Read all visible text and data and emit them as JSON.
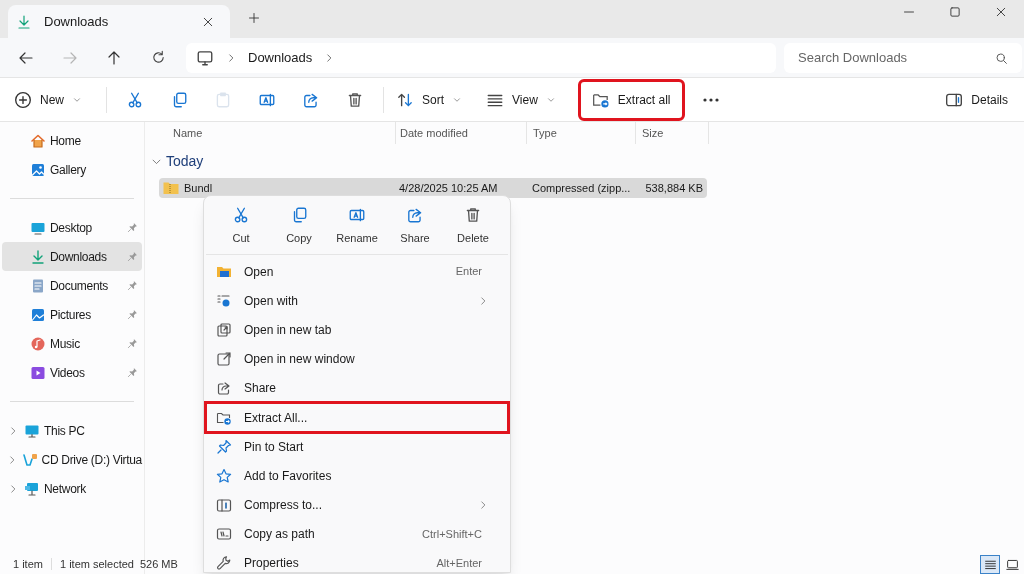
{
  "tab": {
    "title": "Downloads",
    "selected": true
  },
  "breadcrumb": [
    "Downloads"
  ],
  "search": {
    "placeholder": "Search Downloads"
  },
  "toolbar": [
    {
      "label": "New",
      "dropdown": true,
      "disabled": false,
      "highlighted": false
    },
    {
      "disabled": false,
      "highlighted": false,
      "kind": "cut"
    },
    {
      "disabled": false,
      "highlighted": false,
      "kind": "copy"
    },
    {
      "disabled": true,
      "highlighted": false,
      "kind": "paste"
    },
    {
      "disabled": false,
      "highlighted": false,
      "kind": "rename"
    },
    {
      "disabled": false,
      "highlighted": false,
      "kind": "share"
    },
    {
      "disabled": false,
      "highlighted": false,
      "kind": "delete"
    },
    {
      "label": "Sort",
      "dropdown": true,
      "disabled": false,
      "highlighted": false,
      "kind": "sort"
    },
    {
      "label": "View",
      "dropdown": true,
      "disabled": false,
      "highlighted": false,
      "kind": "view"
    },
    {
      "label": "Extract all",
      "disabled": false,
      "highlighted": true,
      "kind": "extract"
    },
    {
      "disabled": false,
      "highlighted": false,
      "kind": "more"
    }
  ],
  "details_button": "Details",
  "sidebar": [
    [
      {
        "label": "Home",
        "selected": false,
        "pinned": false
      },
      {
        "label": "Gallery",
        "selected": false,
        "pinned": false
      }
    ],
    [
      {
        "label": "Desktop",
        "selected": false,
        "pinned": true
      },
      {
        "label": "Downloads",
        "selected": true,
        "pinned": true
      },
      {
        "label": "Documents",
        "selected": false,
        "pinned": true
      },
      {
        "label": "Pictures",
        "selected": false,
        "pinned": true
      },
      {
        "label": "Music",
        "selected": false,
        "pinned": true
      },
      {
        "label": "Videos",
        "selected": false,
        "pinned": true
      }
    ],
    [
      {
        "label": "This PC",
        "selected": false,
        "pinned": false,
        "expanded": false
      },
      {
        "label": "CD Drive (D:) Virtua",
        "selected": false,
        "pinned": false,
        "expanded": false
      },
      {
        "label": "Network",
        "selected": false,
        "pinned": false,
        "expanded": false
      }
    ]
  ],
  "columns": [
    "Name",
    "Date modified",
    "Type",
    "Size"
  ],
  "group": {
    "label": "Today",
    "expanded": true
  },
  "rows": [
    {
      "name": "Bundl",
      "date": "4/28/2025 10:25 AM",
      "type": "Compressed (zipp...",
      "size": "538,884 KB",
      "selected": true
    }
  ],
  "context_menu": {
    "actions": [
      "Cut",
      "Copy",
      "Rename",
      "Share",
      "Delete"
    ],
    "items": [
      {
        "label": "Open",
        "shortcut": "Enter",
        "submenu": false,
        "highlighted": false
      },
      {
        "label": "Open with",
        "submenu": true,
        "highlighted": false
      },
      {
        "label": "Open in new tab",
        "submenu": false,
        "highlighted": false
      },
      {
        "label": "Open in new window",
        "submenu": false,
        "highlighted": false
      },
      {
        "label": "Share",
        "submenu": false,
        "highlighted": false
      },
      {
        "label": "Extract All...",
        "submenu": false,
        "highlighted": true
      },
      {
        "label": "Pin to Start",
        "submenu": false,
        "highlighted": false
      },
      {
        "label": "Add to Favorites",
        "submenu": false,
        "highlighted": false
      },
      {
        "label": "Compress to...",
        "submenu": true,
        "highlighted": false
      },
      {
        "label": "Copy as path",
        "shortcut": "Ctrl+Shift+C",
        "submenu": false,
        "highlighted": false
      },
      {
        "label": "Properties",
        "shortcut": "Alt+Enter",
        "submenu": false,
        "highlighted": false
      }
    ]
  },
  "status_bar": {
    "count": "1 item",
    "selection": "1 item selected",
    "size": "526 MB"
  },
  "view_buttons": [
    {
      "selected": true
    },
    {
      "selected": false
    }
  ]
}
